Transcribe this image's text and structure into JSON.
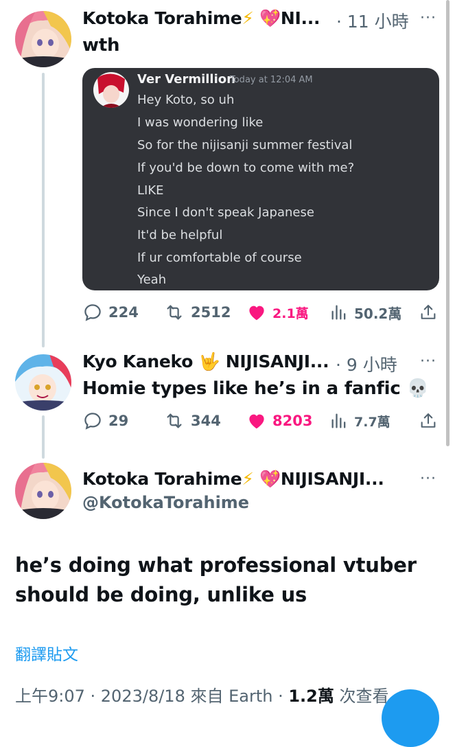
{
  "colors": {
    "accent": "#1d9bf0",
    "like": "#f91880",
    "muted": "#536471",
    "discord_bg": "#313338"
  },
  "tweet1": {
    "author": "Kotoka Torahime",
    "name_suffix": "NI...",
    "time": "· 11 小時",
    "more": "···",
    "text": "wth",
    "discord": {
      "username": "Ver Vermillion",
      "timestamp": "Today at 12:04 AM",
      "lines": [
        "Hey Koto, so uh",
        "I was wondering like",
        "So for the nijisanji summer festival",
        "If you'd be down to come with me?",
        "LIKE",
        "Since I don't speak Japanese",
        "It'd be helpful",
        "If ur comfortable of course",
        "Yeah"
      ]
    },
    "actions": {
      "replies": "224",
      "retweets": "2512",
      "likes": "2.1萬",
      "views": "50.2萬"
    }
  },
  "tweet2": {
    "author": "Kyo Kaneko",
    "name_suffix": "NIJISANJI...",
    "time": "· 9 小時",
    "more": "···",
    "text": "Homie types like he’s in a fanfic",
    "actions": {
      "replies": "29",
      "retweets": "344",
      "likes": "8203",
      "views": "7.7萬"
    }
  },
  "main_tweet": {
    "author": "Kotoka Torahime",
    "name_suffix": "NIJISANJI...",
    "handle": "@KotokaTorahime",
    "more": "···",
    "text_line1": "he’s doing what professional vtuber",
    "text_line2": "should be doing, unlike us",
    "translate_label": "翻譯貼文",
    "meta_time": "上午9:07 · 2023/8/18 來自 Earth · ",
    "meta_views_count": "1.2萬",
    "meta_views_label": " 次查看"
  }
}
